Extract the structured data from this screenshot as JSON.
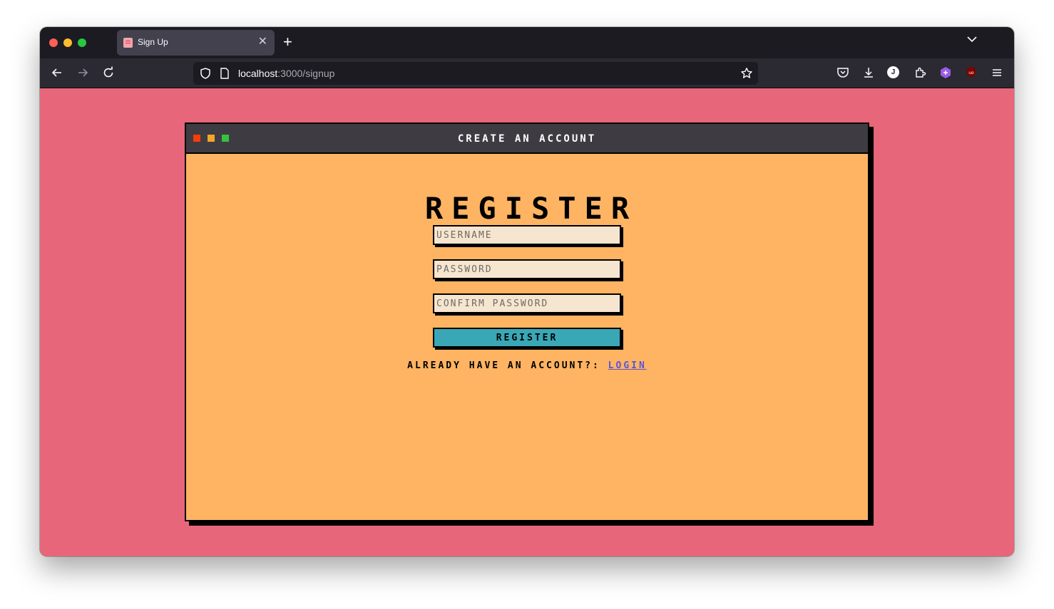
{
  "browser": {
    "tab_title": "Sign Up",
    "url_host": "localhost",
    "url_path": ":3000/signup",
    "account_initial": "J"
  },
  "page": {
    "window_title": "Create an account",
    "heading": "Register",
    "username_placeholder": "Username",
    "password_placeholder": "Password",
    "confirm_placeholder": "Confirm password",
    "register_button": "Register",
    "already_text": "Already have an account?:",
    "login_link": "Login"
  },
  "colors": {
    "page_background": "#e8667a",
    "panel_background": "#feb462",
    "button_background": "#3aa7b7",
    "link": "#5b54d6"
  }
}
